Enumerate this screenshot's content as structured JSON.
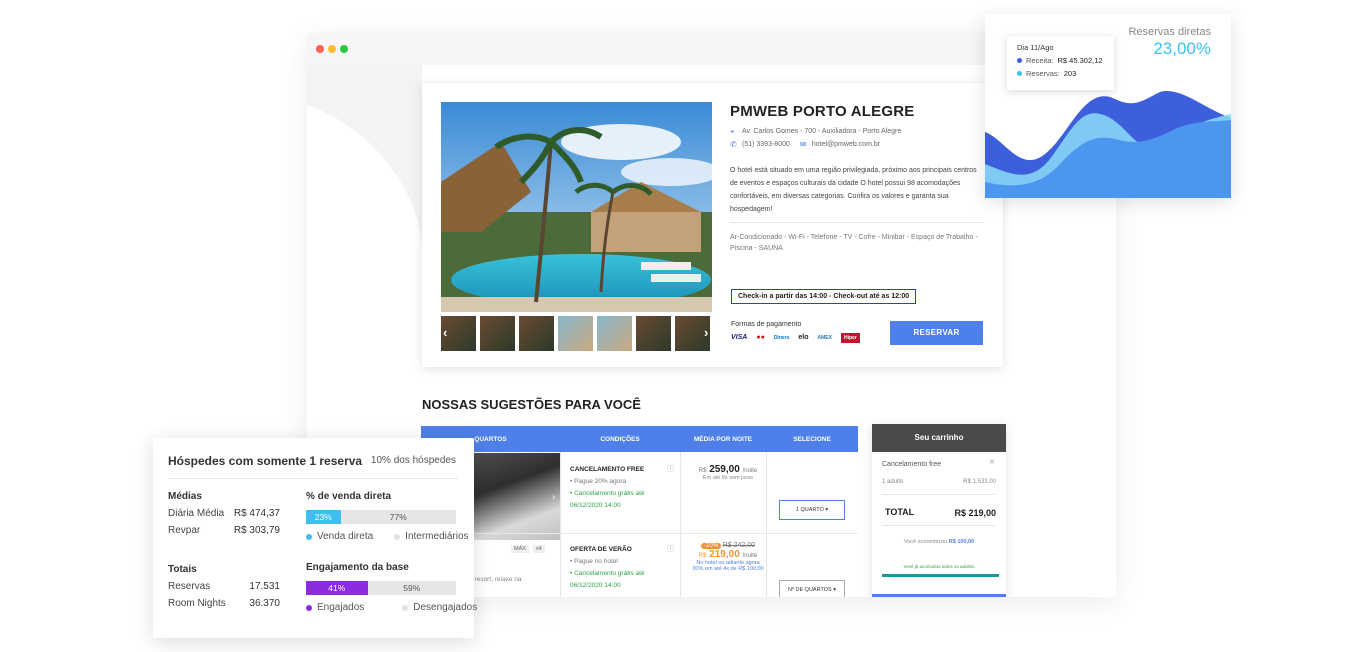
{
  "colors": {
    "accent_blue": "#4f7fe8",
    "cyan": "#3dbff0",
    "purple": "#8a2be2",
    "green": "#2ea043",
    "orange": "#f0952b"
  },
  "hotel": {
    "name": "PMWEB PORTO ALEGRE",
    "address": "Av. Carlos Gomes - 700 - Auxiliadora - Porto Alegre",
    "phone": "(51) 3393-8000",
    "email": "hotel@pmweb.com.br",
    "description": "O hotel está situado em uma região privilegiada, próximo aos principais centros de eventos e espaços culturais da cidade O hotel possui 98 acomodações confortáveis, em diversas categorias. Confira os valores e garanta sua hospedagem!",
    "amenities": "Ar-Condicionado - Wi-Fi - Telefone - TV - Cofre - Minibar - Espaço de Trabalho - Piscina - SAUNA",
    "checkin": "Check-in a partir das 14:00 - Check-out até as 12:00",
    "payments_label": "Formas de pagamento",
    "payments": [
      "VISA",
      "●●",
      "Diners",
      "elo",
      "AMEX",
      "Hiper"
    ],
    "reserve_label": "RESERVAR",
    "icons": {
      "location": "location-icon",
      "phone": "phone-icon",
      "email": "email-icon"
    }
  },
  "suggestions": {
    "title": "NOSSAS SUGESTÕES PARA VOCÊ",
    "headers": [
      "QUARTOS",
      "CONDIÇÕES",
      "MÉDIA POR NOITE",
      "SELECIONE"
    ],
    "rows": [
      {
        "condition_title": "CANCELAMENTO FREE",
        "lines": [
          "• Pague 20% agora",
          "• Cancelamento grátis até",
          "06/12/2020 14:00"
        ],
        "price_prefix": "R$",
        "price": "259,00",
        "per_night": "/noite",
        "note": "Em até 8x sem juros",
        "select": "1 QUARTO"
      },
      {
        "condition_title": "OFERTA DE VERÃO",
        "lines": [
          "• Pague no hotel",
          "• Cancelamento grátis até",
          "06/12/2020 14:00"
        ],
        "discount": "-10%",
        "old_price": "R$ 242,00",
        "price_prefix": "R$",
        "price": "219,00",
        "per_night": "/noite",
        "note": "No hotel ou adiante agora 30% em até 4x de R$ 100,00",
        "select": "Nº DE QUARTOS"
      }
    ],
    "room_badges": [
      "MÁX",
      "x4"
    ],
    "room_text": "cia o resort, relaxe na"
  },
  "cart": {
    "title": "Seu carrinho",
    "item": "Cancelamento free",
    "guests": "1 adulto",
    "item_price": "R$ 1.533,00",
    "total_label": "TOTAL",
    "total_value": "R$ 219,00",
    "savings_label": "Você economizou",
    "savings_value": "R$ 100,00",
    "footer": "Você já acomodou todos os adultos"
  },
  "direct_chart": {
    "title": "Reservas diretas",
    "value": "23,00%",
    "tooltip_date": "Dia 11/Ago",
    "tooltip_revenue_label": "Receita:",
    "tooltip_revenue": "R$ 45.302,12",
    "tooltip_reservations_label": "Reservas:",
    "tooltip_reservations": "203"
  },
  "stats": {
    "title": "Hóspedes com somente 1 reserva",
    "subtitle": "10% dos hóspedes",
    "averages_head": "Médias",
    "daily_label": "Diária Média",
    "daily_value": "R$ 474,37",
    "revpar_label": "Revpar",
    "revpar_value": "R$ 303,79",
    "totals_head": "Totais",
    "reservations_label": "Reservas",
    "reservations_value": "17.531",
    "room_nights_label": "Room Nights",
    "room_nights_value": "36.370",
    "direct_head": "% de venda direta",
    "direct_pct": 23,
    "direct_a": "23%",
    "direct_b": "77%",
    "direct_legend_a": "Venda direta",
    "direct_legend_b": "Intermediários",
    "engagement_head": "Engajamento da base",
    "engagement_pct": 41,
    "engagement_a": "41%",
    "engagement_b": "59%",
    "engagement_legend_a": "Engajados",
    "engagement_legend_b": "Desengajados"
  }
}
